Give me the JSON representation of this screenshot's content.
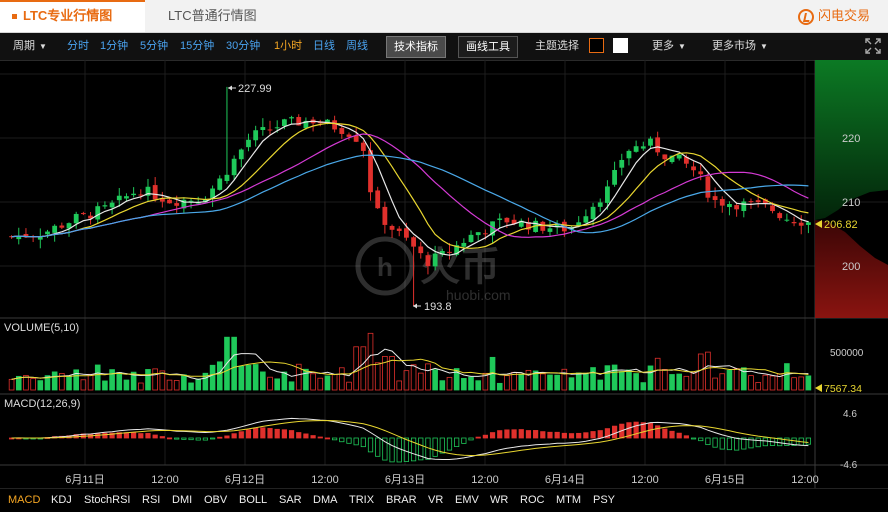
{
  "tabs": {
    "pro": "LTC专业行情图",
    "normal": "LTC普通行情图"
  },
  "brand": "闪电交易",
  "toolbar": {
    "period": "周期",
    "intervals": [
      "分时",
      "1分钟",
      "5分钟",
      "15分钟",
      "30分钟",
      "1小时",
      "日线",
      "周线"
    ],
    "active_interval": "1小时",
    "tech_button": "技术指标",
    "draw_button": "画线工具",
    "theme_label": "主题选择",
    "more": "更多",
    "more_markets": "更多市场"
  },
  "price_panel": {
    "y_ticks": [
      "220",
      "210",
      "200"
    ],
    "high_label": "227.99",
    "low_label": "193.8",
    "last_price": "206.82",
    "watermark_text": "火币",
    "watermark_url": "huobi.com"
  },
  "volume_panel": {
    "label": "VOLUME(5,10)",
    "y_tick": "500000",
    "last_value": "7567.34"
  },
  "macd_panel": {
    "label": "MACD(12,26,9)",
    "y_top": "4.6",
    "y_bottom": "-4.6"
  },
  "x_axis": [
    "6月11日",
    "12:00",
    "6月12日",
    "12:00",
    "6月13日",
    "12:00",
    "6月14日",
    "12:00",
    "6月15日",
    "12:00"
  ],
  "indicators": [
    "MACD",
    "KDJ",
    "StochRSI",
    "RSI",
    "DMI",
    "OBV",
    "BOLL",
    "SAR",
    "DMA",
    "TRIX",
    "BRAR",
    "VR",
    "EMV",
    "WR",
    "ROC",
    "MTM",
    "PSY"
  ],
  "active_indicator": "MACD",
  "colors": {
    "up": "#1fc95a",
    "down": "#e0302c",
    "accent": "#e86b12",
    "ma_white": "#e8e8e8",
    "ma_yellow": "#e8d630",
    "ma_magenta": "#d43ad4",
    "ma_blue": "#4aa8e8"
  }
}
